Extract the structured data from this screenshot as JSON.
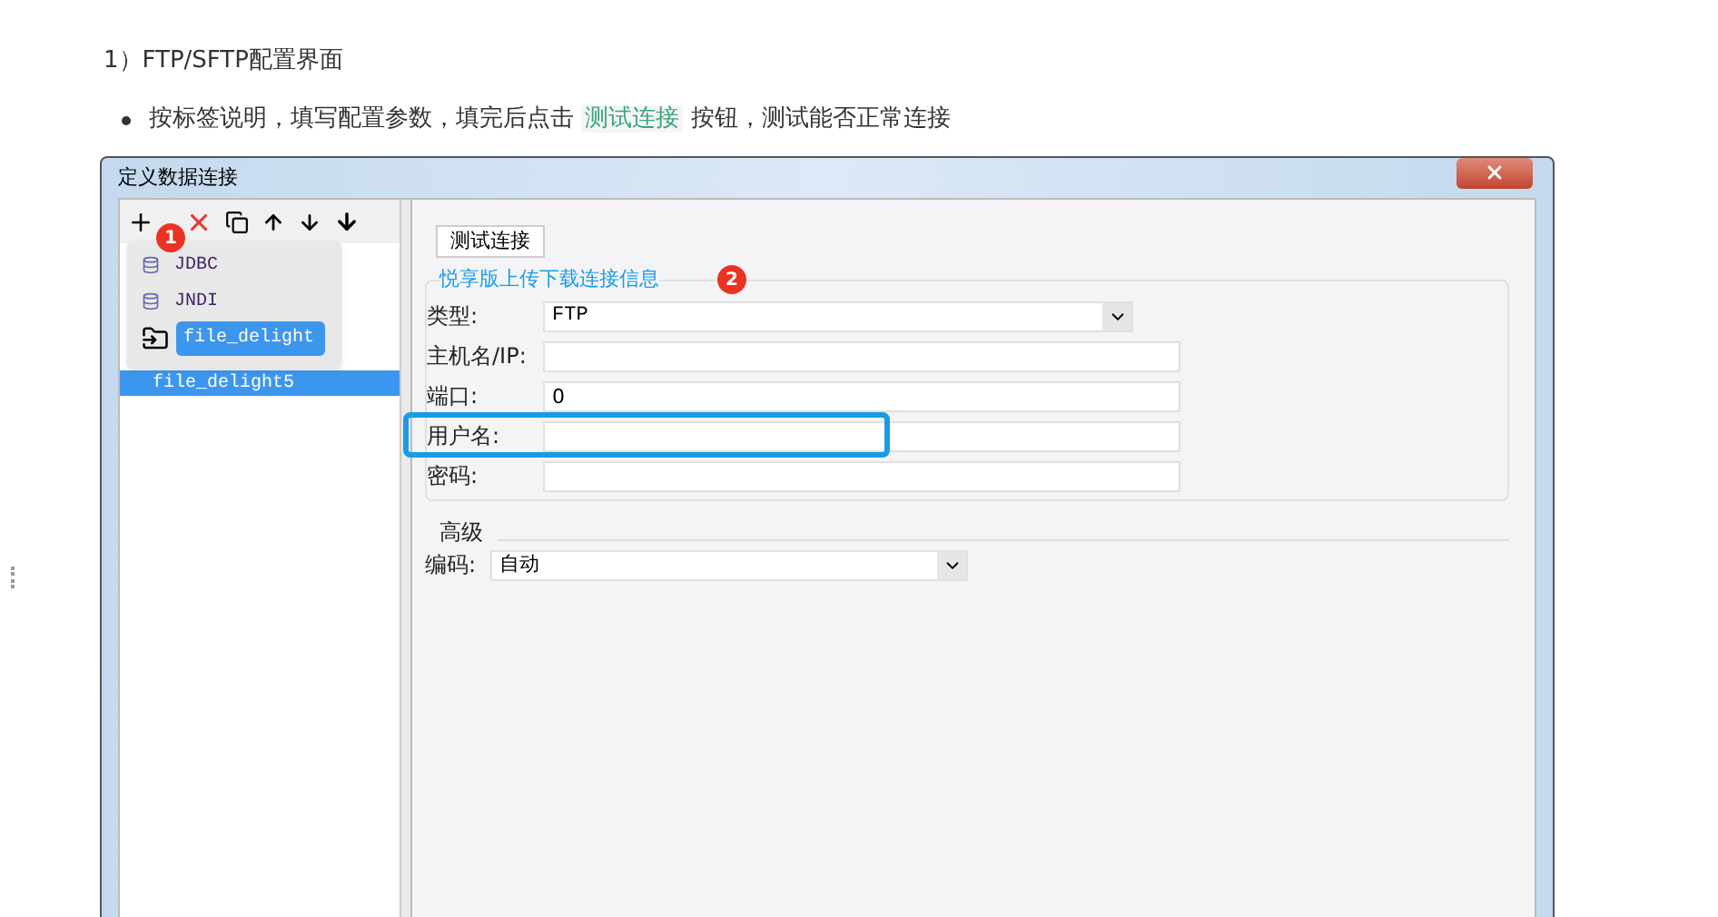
{
  "heading": "1）FTP/SFTP配置界面",
  "bullet": {
    "before": "按标签说明，填写配置参数，填完后点击",
    "code": "测试连接",
    "after": "按钮，测试能否正常连接"
  },
  "window": {
    "title": "定义数据连接"
  },
  "tree": {
    "items": [
      {
        "label": "file_delight5",
        "selected": true
      }
    ]
  },
  "add_menu": {
    "items": [
      {
        "label": "JDBC",
        "kind": "db",
        "selected": false
      },
      {
        "label": "JNDI",
        "kind": "db",
        "selected": false
      },
      {
        "label": "file_delight",
        "kind": "file",
        "selected": true
      }
    ]
  },
  "badges": [
    {
      "label": "1"
    },
    {
      "label": "2"
    }
  ],
  "test_button": "测试连接",
  "group": {
    "title": "悦享版上传下载连接信息",
    "fields": [
      {
        "label": "类型:",
        "kind": "select",
        "value": "FTP"
      },
      {
        "label": "主机名/IP:",
        "kind": "input"
      },
      {
        "label": "端口:",
        "kind": "input",
        "value": "0"
      },
      {
        "label": "用户名:",
        "kind": "input"
      },
      {
        "label": "密码:",
        "kind": "input"
      }
    ]
  },
  "advanced": {
    "title": "高级",
    "label": "编码:",
    "value": "自动"
  }
}
